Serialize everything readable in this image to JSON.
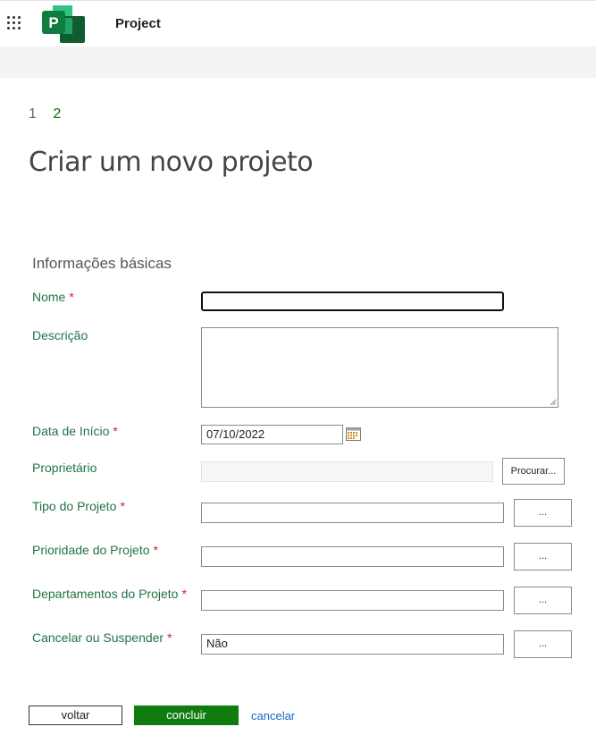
{
  "header": {
    "app_name": "Project"
  },
  "wizard": {
    "steps": [
      "1",
      "2"
    ]
  },
  "page": {
    "title": "Criar um novo projeto"
  },
  "form": {
    "section_title": "Informações básicas",
    "required_mark": "*",
    "fields": {
      "nome": {
        "label": "Nome",
        "value": ""
      },
      "descricao": {
        "label": "Descrição",
        "value": ""
      },
      "data_inicio": {
        "label": "Data de Início",
        "value": "07/10/2022"
      },
      "proprietario": {
        "label": "Proprietário",
        "value": "",
        "button": "Procurar..."
      },
      "tipo": {
        "label": "Tipo do Projeto",
        "value": "",
        "button": "..."
      },
      "prioridade": {
        "label": "Prioridade do Projeto",
        "value": "",
        "button": "..."
      },
      "departamentos": {
        "label": "Departamentos do Projeto",
        "value": "",
        "button": "..."
      },
      "cancelar_suspender": {
        "label": "Cancelar ou Suspender",
        "value": "Não",
        "button": "..."
      }
    }
  },
  "actions": {
    "back": "voltar",
    "finish": "concluir",
    "cancel": "cancelar"
  },
  "colors": {
    "accent_green": "#107c10",
    "label_green": "#217346",
    "required_red": "#c4262e",
    "link_blue": "#0f6cbd"
  }
}
